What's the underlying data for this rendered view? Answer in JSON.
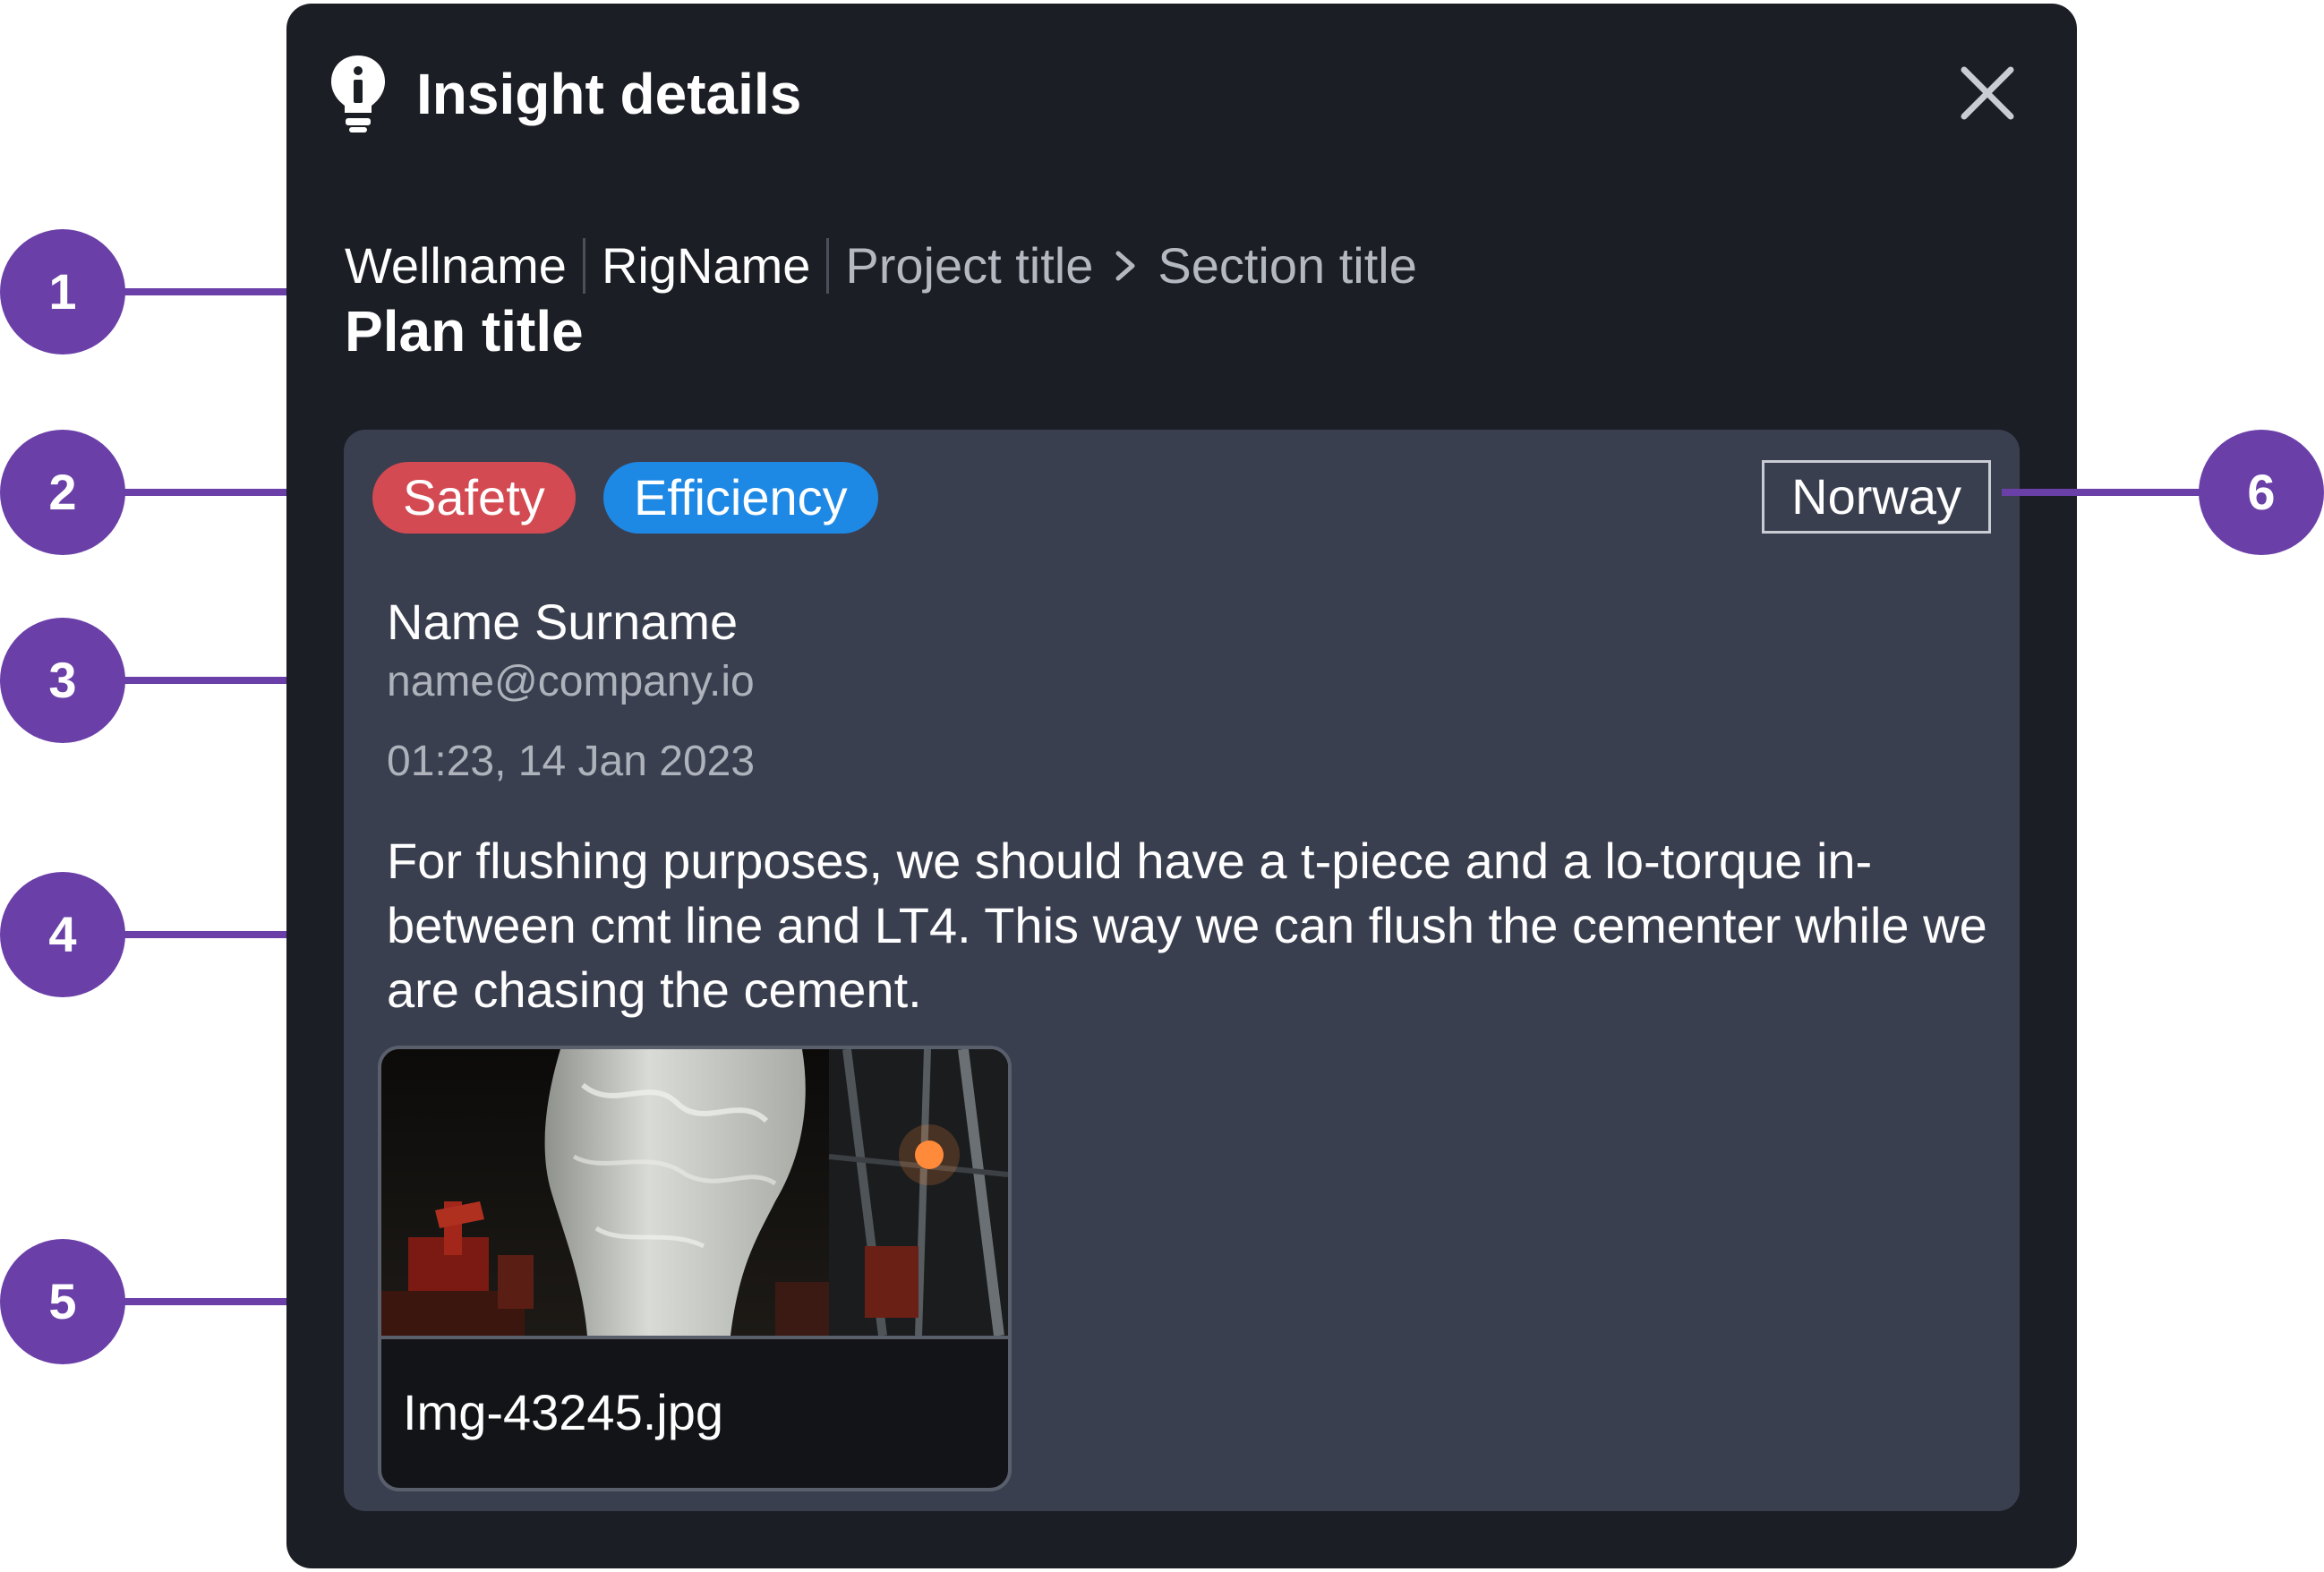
{
  "header": {
    "title": "Insight details",
    "icon": "lightbulb-info-icon",
    "close_icon": "close-icon"
  },
  "breadcrumb": {
    "well": "Wellname",
    "rig": "RigName",
    "project": "Project title",
    "section": "Section title",
    "plan": "Plan title"
  },
  "tags": [
    {
      "label": "Safety",
      "color": "#d44a52"
    },
    {
      "label": "Efficiency",
      "color": "#1e88e5"
    }
  ],
  "country": "Norway",
  "author": {
    "name": "Name Surname",
    "email": "name@company.io"
  },
  "timestamp": "01:23, 14 Jan 2023",
  "body": "For flushing purposes, we should have a t-piece and a lo-torque in-between cmt line and LT4. This way we can flush the cementer while we are chasing the cement.",
  "attachment": {
    "filename": "Img-43245.jpg"
  },
  "callouts": [
    "1",
    "2",
    "3",
    "4",
    "5",
    "6"
  ],
  "colors": {
    "panel": "#1b1e24",
    "card": "#3a3f50",
    "callout": "#6a3fa8"
  }
}
